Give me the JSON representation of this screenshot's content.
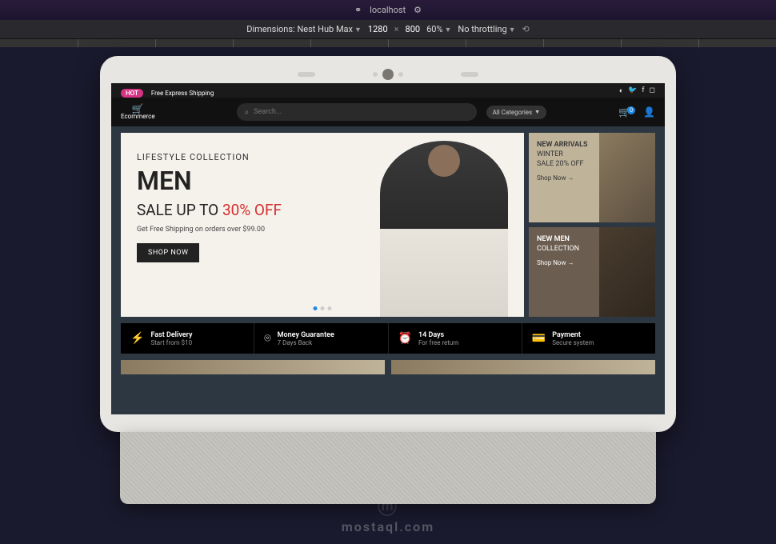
{
  "browser": {
    "host": "localhost"
  },
  "devtools": {
    "dimensions_label": "Dimensions: Nest Hub Max",
    "width": "1280",
    "height": "800",
    "zoom": "60%",
    "throttling": "No throttling"
  },
  "topstrip": {
    "hot": "HOT",
    "shipping": "Free Express Shipping"
  },
  "nav": {
    "brand": "Ecommerce",
    "search_placeholder": "Search...",
    "categories": "All Categories",
    "cart_count": "0"
  },
  "hero": {
    "subtitle": "LIFESTYLE COLLECTION",
    "title": "MEN",
    "sale_prefix": "SALE UP TO ",
    "sale_pct": "30% OFF",
    "note": "Get Free Shipping on orders over $99.00",
    "cta": "SHOP NOW"
  },
  "side_cards": [
    {
      "t1": "NEW ARRIVALS",
      "t2a": "WINTER",
      "t2b": "SALE 20% OFF",
      "link": "Shop Now →"
    },
    {
      "t1": "NEW MEN",
      "t2a": "COLLECTION",
      "t2b": "",
      "link": "Shop Now →"
    }
  ],
  "features": [
    {
      "title": "Fast Delivery",
      "sub": "Start from $10"
    },
    {
      "title": "Money Guarantee",
      "sub": "7 Days Back"
    },
    {
      "title": "14 Days",
      "sub": "For free return"
    },
    {
      "title": "Payment",
      "sub": "Secure system"
    }
  ],
  "watermark": "mostaql.com"
}
